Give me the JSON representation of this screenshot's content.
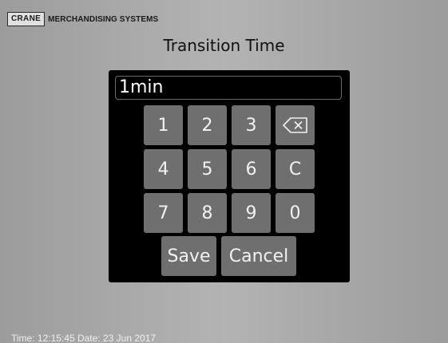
{
  "brand": {
    "logo_text": "CRANE",
    "name": "MERCHANDISING SYSTEMS"
  },
  "page": {
    "title": "Transition Time"
  },
  "keypad": {
    "display_value": "1min",
    "keys": {
      "k1": "1",
      "k2": "2",
      "k3": "3",
      "k4": "4",
      "k5": "5",
      "k6": "6",
      "k7": "7",
      "k8": "8",
      "k9": "9",
      "k0": "0",
      "clear": "C",
      "backspace_icon": "backspace-icon"
    },
    "save_label": "Save",
    "cancel_label": "Cancel"
  },
  "status": {
    "time_label": "Time:",
    "time": "12:15:45",
    "date_label": "Date:",
    "date": "23 Jun 2017"
  },
  "colors": {
    "background": "#aaaaaa",
    "panel": "#000000",
    "key": "#6f6f6f",
    "text_on_key": "#f2f2f2"
  }
}
